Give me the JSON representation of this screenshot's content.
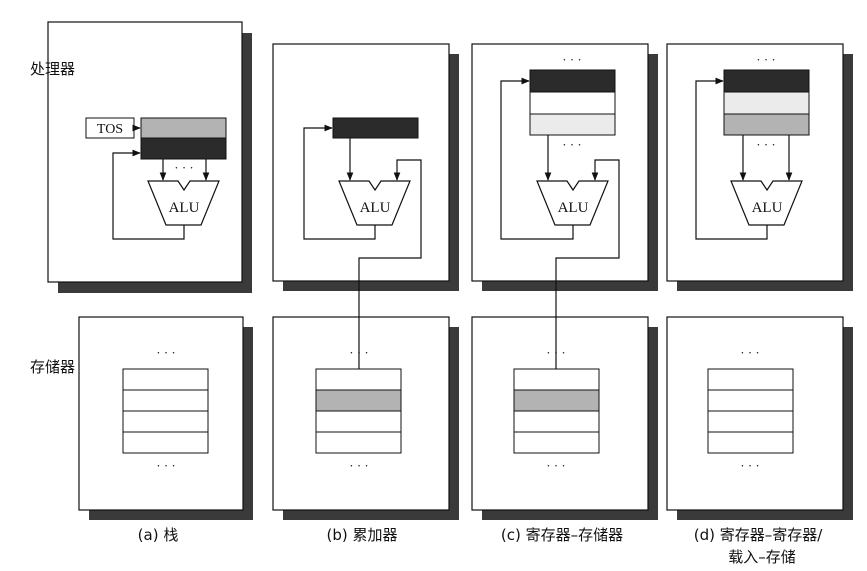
{
  "labels": {
    "processor": "处理器",
    "memory": "存储器",
    "tos": "TOS",
    "alu": "ALU",
    "ellipsis": "· · ·"
  },
  "captions": {
    "a": "(a) 栈",
    "b": "(b) 累加器",
    "c": "(c) 寄存器–存储器",
    "d_line1": "(d) 寄存器–寄存器/",
    "d_line2": "载入–存储"
  },
  "colors": {
    "dark_register": "#2b2b2b",
    "medium_register": "#b3b3b3",
    "light_register": "#ebebeb",
    "panel_shadow": "#3a3a3a",
    "line": "#111111"
  }
}
